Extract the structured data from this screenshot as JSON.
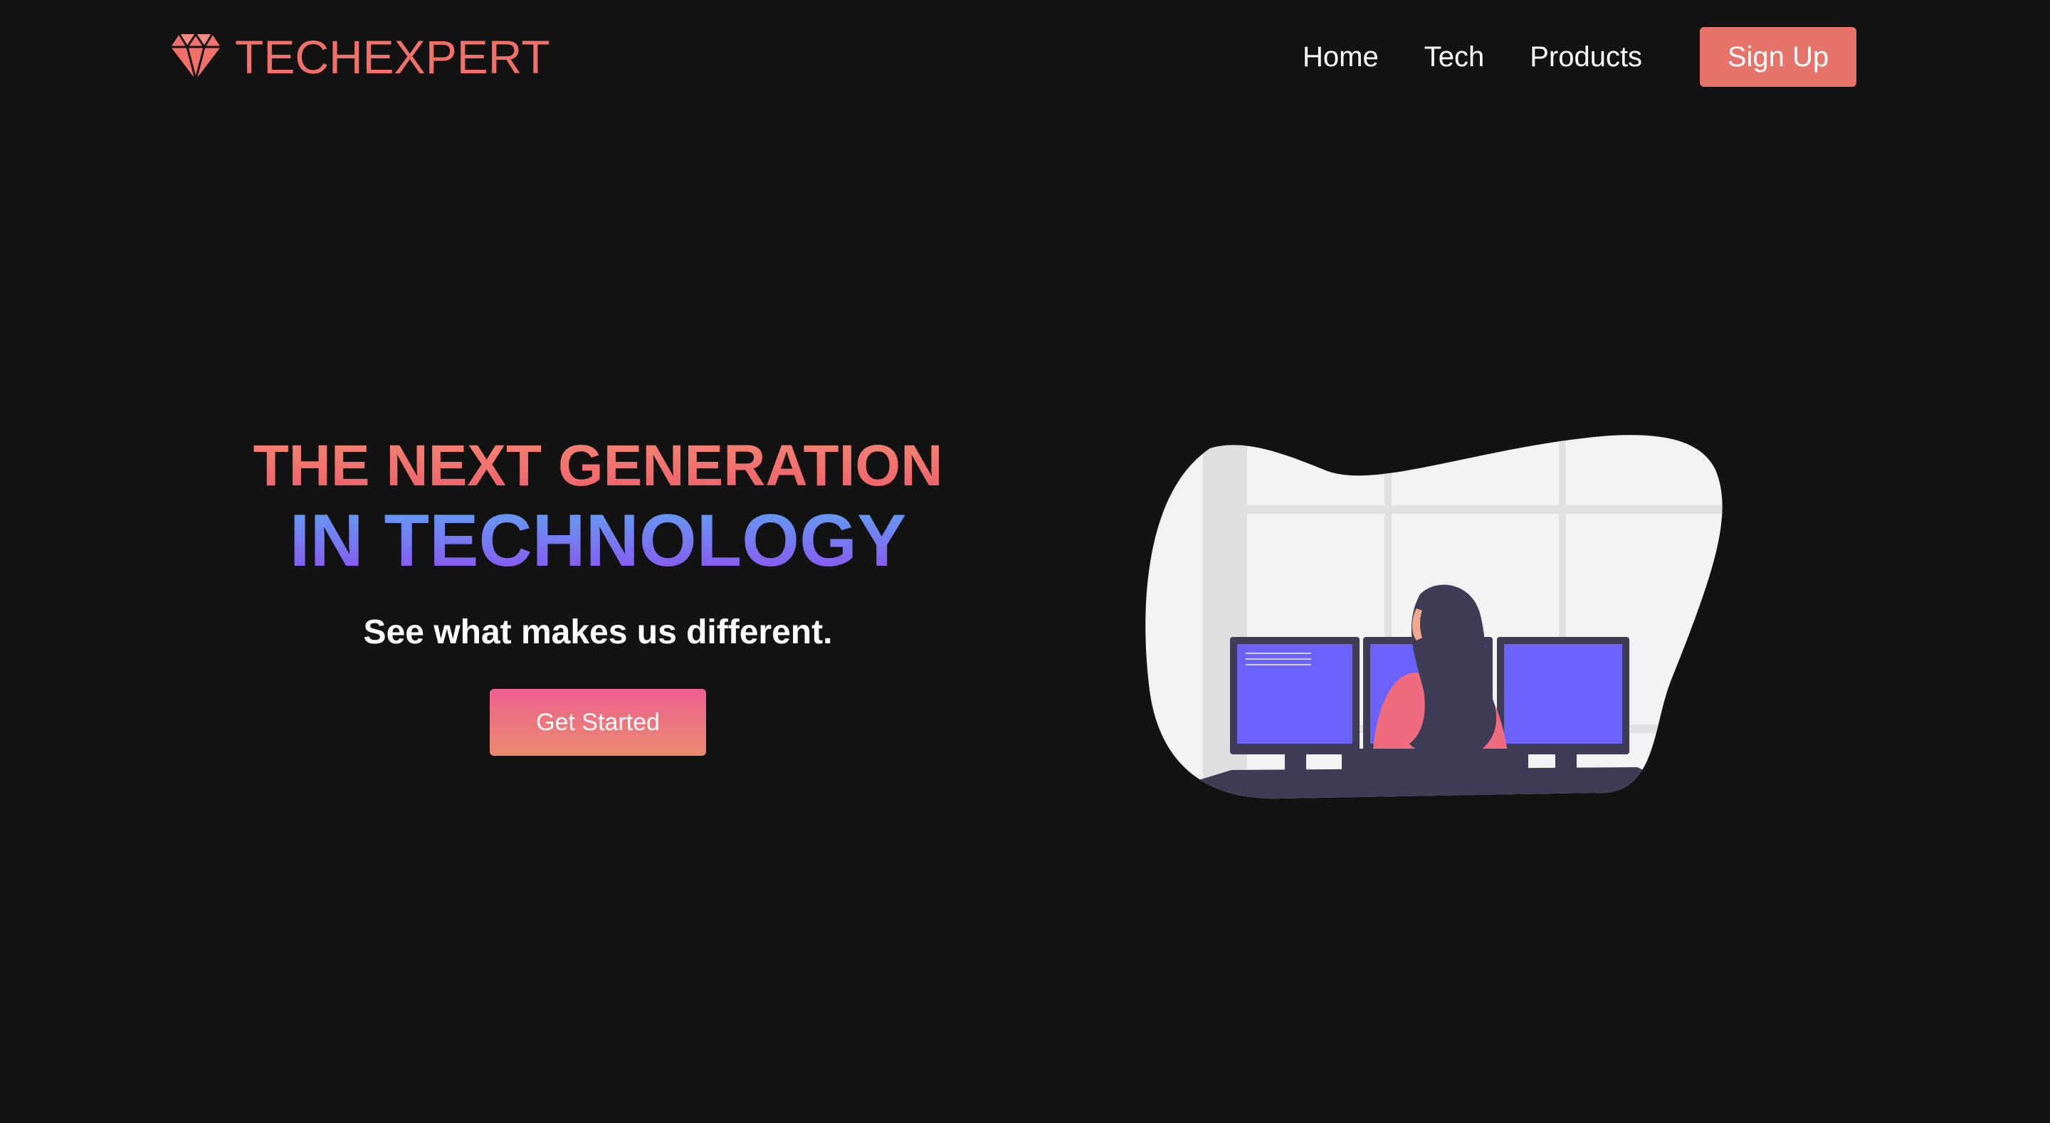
{
  "navbar": {
    "brand": "TECHEXPERT",
    "brand_icon": "diamond-icon",
    "links": [
      {
        "label": "Home"
      },
      {
        "label": "Tech"
      },
      {
        "label": "Products"
      }
    ],
    "signup_label": "Sign Up"
  },
  "hero": {
    "headline_line1": "THE NEXT GENERATION",
    "headline_line2": "IN TECHNOLOGY",
    "subheadline": "See what makes us different.",
    "cta_label": "Get Started",
    "illustration": "woman-at-computer-desk-illustration"
  },
  "colors": {
    "background": "#131313",
    "brand": "#f2706a",
    "signup_button": "#e6736a",
    "monitor_screen": "#6c63ff",
    "headline_top": "#f2706a",
    "headline_bottom": "#7b5cf0"
  }
}
